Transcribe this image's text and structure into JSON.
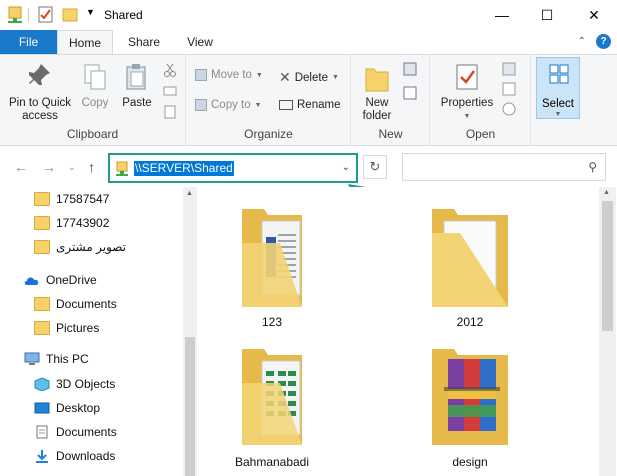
{
  "window": {
    "title": "Shared",
    "minimize_glyph": "—",
    "maximize_glyph": "☐",
    "close_glyph": "✕"
  },
  "tabs": [
    {
      "label": "File"
    },
    {
      "label": "Home"
    },
    {
      "label": "Share"
    },
    {
      "label": "View"
    }
  ],
  "ribbon": {
    "clipboard": {
      "label": "Clipboard",
      "pin_line1": "Pin to Quick",
      "pin_line2": "access",
      "copy": "Copy",
      "paste": "Paste"
    },
    "organize": {
      "label": "Organize",
      "move_to": "Move to",
      "copy_to": "Copy to",
      "delete": "Delete",
      "rename": "Rename"
    },
    "new": {
      "label": "New",
      "new_folder_line1": "New",
      "new_folder_line2": "folder"
    },
    "open": {
      "label": "Open",
      "properties": "Properties"
    },
    "select": {
      "label": "Select"
    }
  },
  "address": {
    "path": "\\\\SERVER\\Shared"
  },
  "nav": {
    "items": [
      {
        "label": "17587547",
        "icon": "folder-icon"
      },
      {
        "label": "17743902",
        "icon": "folder-icon"
      },
      {
        "label": "تصویر مشتری",
        "icon": "folder-icon"
      },
      {
        "label": "OneDrive",
        "icon": "cloud-icon"
      },
      {
        "label": "Documents",
        "icon": "folder-icon"
      },
      {
        "label": "Pictures",
        "icon": "folder-icon"
      },
      {
        "label": "This PC",
        "icon": "computer-icon"
      },
      {
        "label": "3D Objects",
        "icon": "cube-icon"
      },
      {
        "label": "Desktop",
        "icon": "desktop-icon"
      },
      {
        "label": "Documents",
        "icon": "documents-icon"
      },
      {
        "label": "Downloads",
        "icon": "download-icon"
      }
    ]
  },
  "files": [
    {
      "name": "123"
    },
    {
      "name": "2012"
    },
    {
      "name": "Bahmanabadi"
    },
    {
      "name": "design"
    }
  ],
  "colors": {
    "accent": "#1979ca",
    "highlight": "#0078d7",
    "annotation": "#1f9e8a"
  }
}
